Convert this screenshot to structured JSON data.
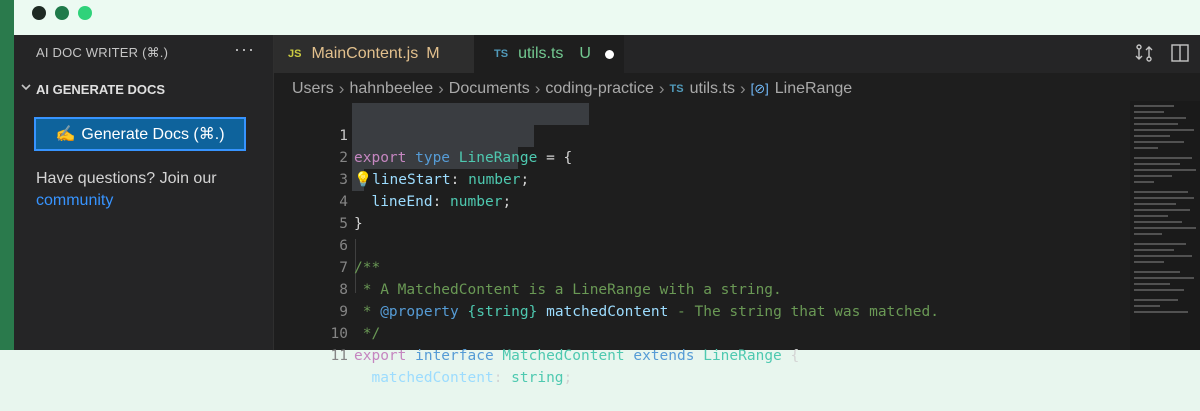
{
  "window": {
    "traffic_lights": [
      "close",
      "minimize",
      "maximize"
    ]
  },
  "sidebar": {
    "title": "AI DOC WRITER (⌘.)",
    "more_label": "···",
    "section_title": "AI GENERATE DOCS",
    "generate_button": {
      "icon": "✍️",
      "label": "Generate Docs (⌘.)"
    },
    "help_text": "Have questions? Join our",
    "community_link": "community"
  },
  "tabs": [
    {
      "badge": "JS",
      "name": "MainContent.js",
      "status": "M",
      "active": false
    },
    {
      "badge": "TS",
      "name": "utils.ts",
      "status": "U",
      "active": true,
      "dirty": true
    }
  ],
  "breadcrumb": {
    "parts": [
      "Users",
      "hahnbeelee",
      "Documents",
      "coding-practice"
    ],
    "file_badge": "TS",
    "file": "utils.ts",
    "symbol_icon": "[⊘]",
    "symbol": "LineRange"
  },
  "editor": {
    "line_numbers": [
      "1",
      "2",
      "3",
      "4",
      "5",
      "6",
      "7",
      "8",
      "9",
      "10",
      "11"
    ],
    "tokens": {
      "l1_export": "export",
      "l1_type": " type ",
      "l1_name": "LineRange",
      "l1_rest": " = {",
      "l2_bulb": "💡",
      "l2_prop": "lineStart",
      "l2_colon": ": ",
      "l2_type": "number",
      "l2_end": ";",
      "l3_indent": "  ",
      "l3_prop": "lineEnd",
      "l3_colon": ": ",
      "l3_type": "number",
      "l3_end": ";",
      "l4": "}",
      "l6": "/**",
      "l7": " * A MatchedContent is a LineRange with a string.",
      "l8_prefix": " * ",
      "l8_tag": "@property",
      "l8_type": " {string} ",
      "l8_name": "matchedContent",
      "l8_desc": " - The string that was matched.",
      "l9": " */",
      "l10_export": "export",
      "l10_interface": " interface ",
      "l10_name": "MatchedContent",
      "l10_extends": " extends ",
      "l10_base": "LineRange",
      "l10_rest": " {",
      "l11_indent": "  ",
      "l11_prop": "matchedContent",
      "l11_colon": ": ",
      "l11_type": "string",
      "l11_end": ";"
    }
  },
  "colors": {
    "accent_button": "#0e639c",
    "link": "#3794ff",
    "modified_tab": "#e2c08d",
    "untracked_tab": "#73c991"
  }
}
